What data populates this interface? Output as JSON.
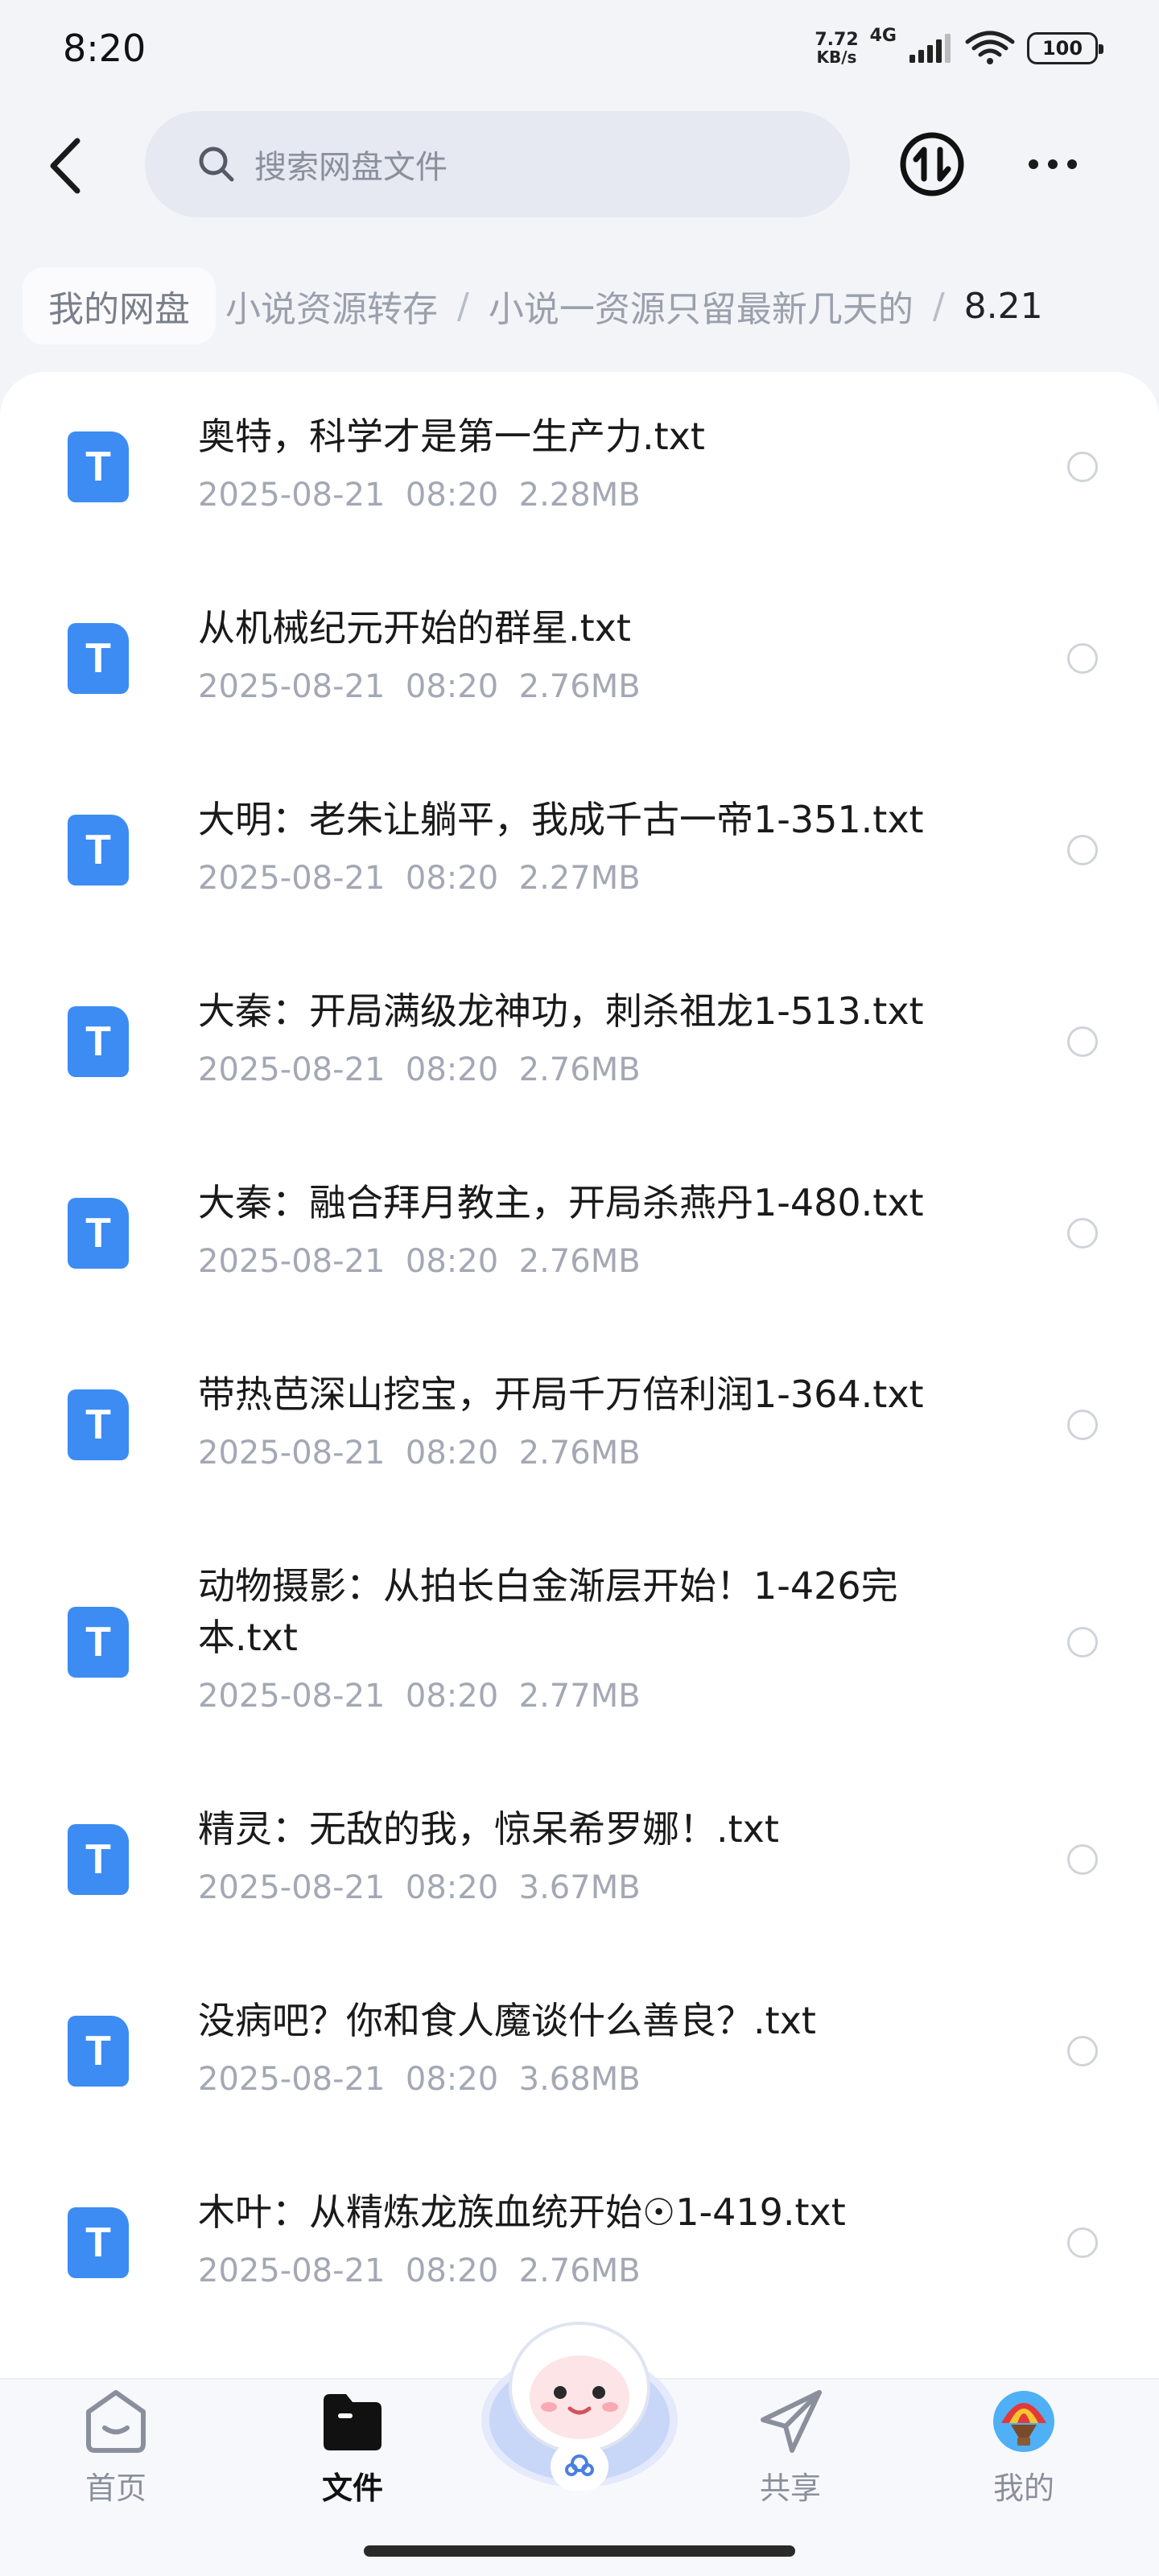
{
  "status": {
    "time": "8:20",
    "net_speed": "7.72",
    "net_unit": "KB/s",
    "net_type": "4G",
    "battery": "100"
  },
  "search": {
    "placeholder": "搜索网盘文件"
  },
  "breadcrumb": {
    "root": "我的网盘",
    "items": [
      "小说资源转存",
      "小说一资源只留最新几天的"
    ],
    "separator": "/",
    "current": "8.21"
  },
  "files": [
    {
      "name": "奥特，科学才是第一生产力.txt",
      "date": "2025-08-21",
      "time": "08:20",
      "size": "2.28MB"
    },
    {
      "name": "从机械纪元开始的群星.txt",
      "date": "2025-08-21",
      "time": "08:20",
      "size": "2.76MB"
    },
    {
      "name": "大明：老朱让躺平，我成千古一帝1-351.txt",
      "date": "2025-08-21",
      "time": "08:20",
      "size": "2.27MB"
    },
    {
      "name": "大秦：开局满级龙神功，刺杀祖龙1-513.txt",
      "date": "2025-08-21",
      "time": "08:20",
      "size": "2.76MB"
    },
    {
      "name": "大秦：融合拜月教主，开局杀燕丹1-480.txt",
      "date": "2025-08-21",
      "time": "08:20",
      "size": "2.76MB"
    },
    {
      "name": "带热芭深山挖宝，开局千万倍利润1-364.txt",
      "date": "2025-08-21",
      "time": "08:20",
      "size": "2.76MB"
    },
    {
      "name": "动物摄影：从拍长白金渐层开始！1-426完本.txt",
      "date": "2025-08-21",
      "time": "08:20",
      "size": "2.77MB"
    },
    {
      "name": "精灵：无敌的我，惊呆希罗娜！.txt",
      "date": "2025-08-21",
      "time": "08:20",
      "size": "3.67MB"
    },
    {
      "name": "没病吧？你和食人魔谈什么善良？.txt",
      "date": "2025-08-21",
      "time": "08:20",
      "size": "3.68MB"
    },
    {
      "name": "木叶：从精炼龙族血统开始☉1-419.txt",
      "date": "2025-08-21",
      "time": "08:20",
      "size": "2.76MB"
    }
  ],
  "file_icon_letter": "T",
  "nav": {
    "home": "首页",
    "files": "文件",
    "share": "共享",
    "mine": "我的"
  },
  "colors": {
    "accent": "#3c8cf3",
    "background": "#f2f4f8"
  }
}
